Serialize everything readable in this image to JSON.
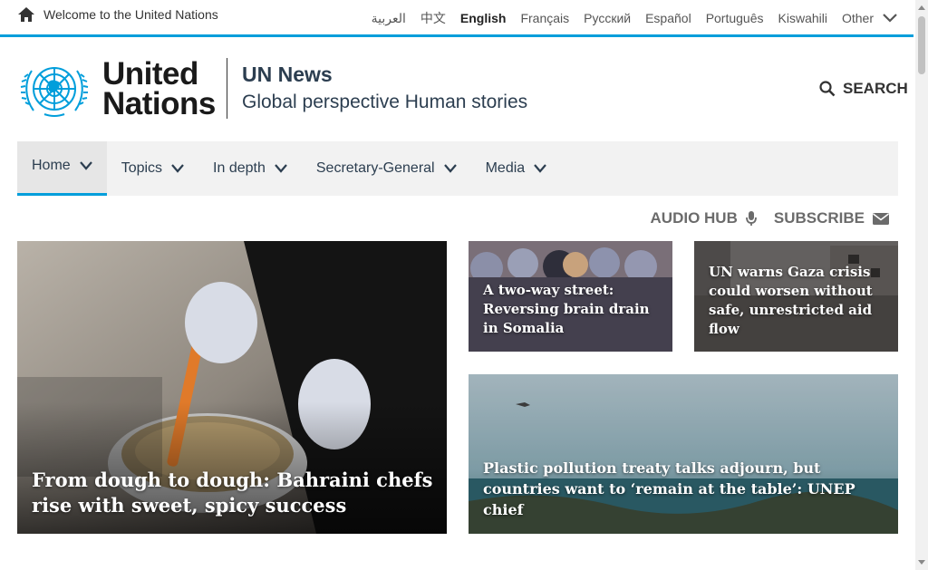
{
  "topbar": {
    "welcome": "Welcome to the United Nations",
    "languages": [
      "العربية",
      "中文",
      "English",
      "Français",
      "Русский",
      "Español",
      "Português",
      "Kiswahili"
    ],
    "active_language": "English",
    "other": "Other"
  },
  "header": {
    "logo_line1": "United",
    "logo_line2": "Nations",
    "site_title": "UN News",
    "tagline": "Global perspective Human stories",
    "search_label": "SEARCH"
  },
  "nav": {
    "items": [
      "Home",
      "Topics",
      "In depth",
      "Secretary-General",
      "Media"
    ]
  },
  "utility": {
    "audio_hub": "AUDIO HUB",
    "subscribe": "SUBSCRIBE"
  },
  "stories": [
    {
      "title": "From dough to dough: Bahraini chefs rise with sweet, spicy success"
    },
    {
      "title": "A two-way street: Reversing brain drain in Somalia"
    },
    {
      "title": "UN warns Gaza crisis could worsen without safe, unrestricted aid flow"
    },
    {
      "title": "Plastic pollution treaty talks adjourn, but countries want to ‘remain at the table’: UNEP chief"
    }
  ],
  "colors": {
    "accent": "#009edb",
    "nav_bg": "#f2f2f2",
    "text_dark": "#2c3e50"
  },
  "icons": {
    "home": "home-icon",
    "chevron": "chevron-down-icon",
    "search": "search-icon",
    "mic": "microphone-icon",
    "mail": "envelope-icon"
  }
}
